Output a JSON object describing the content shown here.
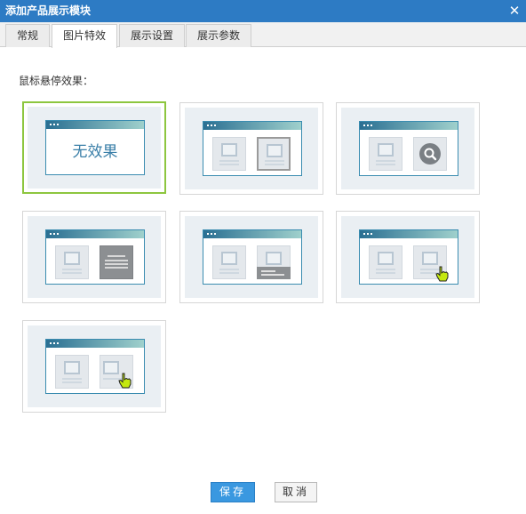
{
  "dialog": {
    "title": "添加产品展示模块",
    "close_icon_glyph": "✕"
  },
  "tabs": [
    {
      "label": "常规",
      "active": false
    },
    {
      "label": "图片特效",
      "active": true
    },
    {
      "label": "展示设置",
      "active": false
    },
    {
      "label": "展示参数",
      "active": false
    }
  ],
  "hover_section": {
    "label": "鼠标悬停效果：",
    "options": [
      {
        "id": "no-effect",
        "label": "无效果",
        "selected": true
      },
      {
        "id": "border-highlight",
        "selected": false
      },
      {
        "id": "magnifier-overlay",
        "selected": false
      },
      {
        "id": "text-cover",
        "selected": false
      },
      {
        "id": "caption-slide-up",
        "selected": false
      },
      {
        "id": "cursor-hover",
        "selected": false
      },
      {
        "id": "cursor-hover-alt",
        "selected": false
      }
    ]
  },
  "footer": {
    "save_label": "保存",
    "cancel_label": "取消"
  },
  "colors": {
    "title_bar": "#2d7bc4",
    "selected_border": "#8dc63f",
    "save_button": "#3a98e0"
  }
}
